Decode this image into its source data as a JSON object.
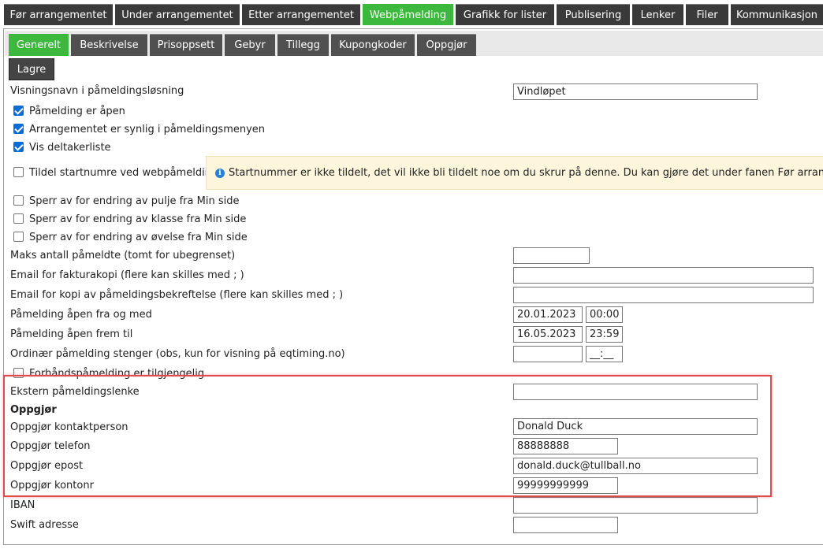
{
  "top_tabs": [
    {
      "label": "Før arrangementet"
    },
    {
      "label": "Under arrangementet"
    },
    {
      "label": "Etter arrangementet"
    },
    {
      "label": "Webpåmelding"
    },
    {
      "label": "Grafikk for lister"
    },
    {
      "label": "Publisering"
    },
    {
      "label": "Lenker"
    },
    {
      "label": "Filer"
    },
    {
      "label": "Kommunikasjon"
    }
  ],
  "sub_tabs": [
    {
      "label": "Generelt"
    },
    {
      "label": "Beskrivelse"
    },
    {
      "label": "Prisoppsett"
    },
    {
      "label": "Gebyr"
    },
    {
      "label": "Tillegg"
    },
    {
      "label": "Kupongkoder"
    },
    {
      "label": "Oppgjør"
    }
  ],
  "save_label": "Lagre",
  "form": {
    "display_name": {
      "label": "Visningsnavn i påmeldingsløsning",
      "value": "Vindløpet"
    },
    "checkboxes": [
      {
        "label": "Påmelding er åpen",
        "checked": true
      },
      {
        "label": "Arrangementet er synlig i påmeldingsmenyen",
        "checked": true
      },
      {
        "label": "Vis deltakerliste",
        "checked": true
      },
      {
        "label": "Tildel startnumre ved webpåmelding",
        "checked": false
      },
      {
        "label": "Sperr av for endring av pulje fra Min side",
        "checked": false
      },
      {
        "label": "Sperr av for endring av klasse fra Min side",
        "checked": false
      },
      {
        "label": "Sperr av for endring av øvelse fra Min side",
        "checked": false
      }
    ],
    "info_message": "Startnummer er ikke tildelt, det vil ikke bli tildelt noe om du skrur på denne. Du kan gjøre det under fanen Før arrangement",
    "max_participants": {
      "label": "Maks antall påmeldte (tomt for ubegrenset)",
      "value": ""
    },
    "invoice_email": {
      "label": "Email for fakturakopi (flere kan skilles med ; )",
      "value": ""
    },
    "confirm_email": {
      "label": "Email for kopi av påmeldingsbekreftelse (flere kan skilles med ; )",
      "value": ""
    },
    "open_from": {
      "label": "Påmelding åpen fra og med",
      "date": "20.01.2023",
      "time": "00:00"
    },
    "open_until": {
      "label": "Påmelding åpen frem til",
      "date": "16.05.2023",
      "time": "23:59"
    },
    "ordinary_closes": {
      "label": "Ordinær påmelding stenger (obs, kun for visning på eqtiming.no)",
      "date": "",
      "time_placeholder": "__:__"
    },
    "preregistration": {
      "label": "Forhåndspåmelding er tilgjengelig",
      "checked": false
    },
    "external_link": {
      "label": "Ekstern påmeldingslenke",
      "value": ""
    },
    "settlement_heading": "Oppgjør",
    "settlement_contact": {
      "label": "Oppgjør kontaktperson",
      "value": "Donald Duck"
    },
    "settlement_phone": {
      "label": "Oppgjør telefon",
      "value": "88888888"
    },
    "settlement_email": {
      "label": "Oppgjør epost",
      "value": "donald.duck@tullball.no"
    },
    "settlement_account": {
      "label": "Oppgjør kontonr",
      "value": "99999999999"
    },
    "iban": {
      "label": "IBAN",
      "value": ""
    },
    "swift": {
      "label": "Swift adresse",
      "value": ""
    }
  },
  "colors": {
    "accent": "#3cb83c",
    "tab_bg": "#3a3a3a",
    "highlight": "#e04a4a",
    "info_bg": "#fdf5dc",
    "checkbox_on": "#0b6cd3"
  }
}
